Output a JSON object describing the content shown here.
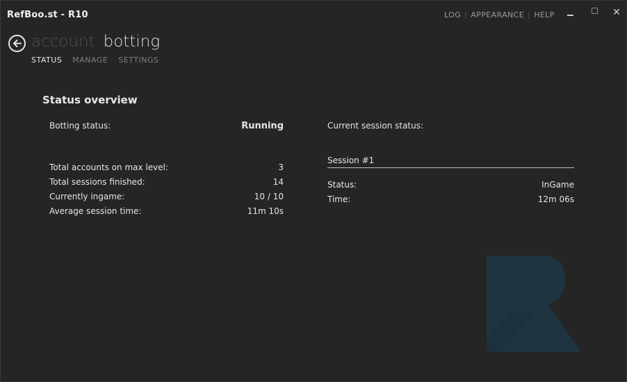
{
  "window": {
    "title": "RefBoo.st - R10",
    "nav": [
      "LOG",
      "APPEARANCE",
      "HELP"
    ],
    "controls": {
      "minimize": "",
      "maximize": "",
      "close": "✕"
    }
  },
  "header": {
    "breadcrumb_prev": "account",
    "breadcrumb_current": "botting",
    "tabs": [
      {
        "label": "STATUS",
        "active": true
      },
      {
        "label": "MANAGE",
        "active": false
      },
      {
        "label": "SETTINGS",
        "active": false
      }
    ]
  },
  "overview": {
    "title": "Status overview",
    "botting_status": {
      "label": "Botting status:",
      "value": "Running"
    },
    "stats": [
      {
        "label": "Total accounts on max level:",
        "value": "3"
      },
      {
        "label": "Total sessions finished:",
        "value": "14"
      },
      {
        "label": "Currently ingame:",
        "value": "10 / 10"
      },
      {
        "label": "Average session time:",
        "value": "11m 10s"
      }
    ]
  },
  "session": {
    "heading": "Current session status:",
    "name": "Session #1",
    "status": {
      "label": "Status:",
      "value": "InGame"
    },
    "time": {
      "label": "Time:",
      "value": "12m 06s"
    }
  },
  "colors": {
    "background": "#252525",
    "logo": "#1e3441"
  },
  "icons": {
    "back": "arrow-left-circle-icon",
    "logo": "refboost-r-logo"
  }
}
